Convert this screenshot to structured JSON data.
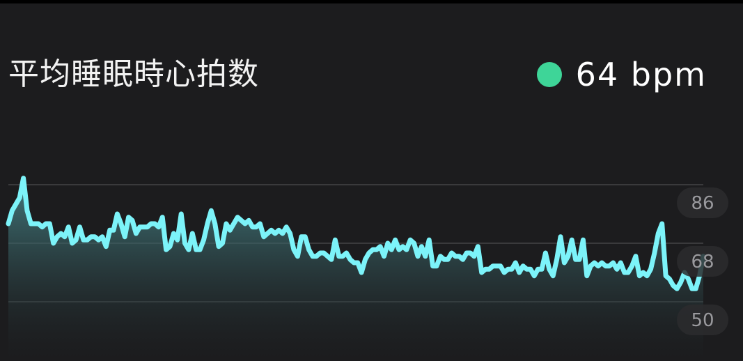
{
  "header": {
    "title": "平均睡眠時心拍数",
    "current_value": "64 bpm",
    "indicator_color": "#3ed598"
  },
  "chart_data": {
    "type": "area",
    "title": "平均睡眠時心拍数",
    "ylabel": "",
    "xlabel": "",
    "ylim": [
      44,
      92
    ],
    "yticks": [
      86,
      68,
      50
    ],
    "grid": true,
    "line_color": "#7cf3f9",
    "series": [
      {
        "values": [
          74,
          78,
          80,
          82,
          88,
          78,
          74,
          74,
          74,
          73,
          74,
          74,
          68,
          70,
          71,
          70,
          73,
          68,
          69,
          73,
          69,
          69,
          70,
          70,
          69,
          70,
          67,
          72,
          72,
          77,
          74,
          70,
          76,
          75,
          71,
          73,
          73,
          73,
          74,
          74,
          73,
          76,
          66,
          67,
          71,
          69,
          77,
          68,
          66,
          71,
          66,
          66,
          69,
          74,
          78,
          74,
          67,
          68,
          74,
          72,
          74,
          76,
          75,
          74,
          75,
          73,
          73,
          74,
          70,
          71,
          72,
          71,
          72,
          71,
          73,
          71,
          66,
          64,
          70,
          70,
          66,
          64,
          64,
          65,
          65,
          64,
          63,
          69,
          64,
          64,
          65,
          63,
          62,
          62,
          59,
          63,
          65,
          66,
          66,
          67,
          64,
          68,
          66,
          69,
          66,
          67,
          66,
          69,
          68,
          64,
          67,
          64,
          69,
          61,
          61,
          64,
          63,
          63,
          65,
          64,
          64,
          63,
          65,
          65,
          64,
          67,
          59,
          60,
          60,
          61,
          61,
          61,
          59,
          60,
          60,
          62,
          59,
          61,
          60,
          60,
          58,
          60,
          60,
          65,
          60,
          58,
          63,
          70,
          62,
          64,
          69,
          63,
          63,
          69,
          58,
          61,
          62,
          61,
          62,
          61,
          61,
          62,
          60,
          62,
          59,
          59,
          61,
          64,
          58,
          59,
          58,
          60,
          65,
          71,
          74,
          58,
          57,
          55,
          54,
          56,
          59,
          57,
          54,
          54,
          58,
          64
        ]
      }
    ]
  }
}
